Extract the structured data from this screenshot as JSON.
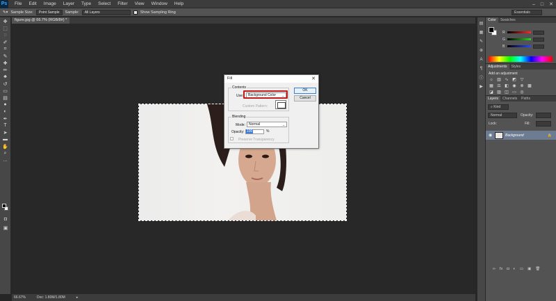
{
  "app": {
    "logo": "Ps"
  },
  "menu": [
    "File",
    "Edit",
    "Image",
    "Layer",
    "Type",
    "Select",
    "Filter",
    "View",
    "Window",
    "Help"
  ],
  "options": {
    "sample_size_label": "Sample Size:",
    "sample_size_value": "Point Sample",
    "sample_label": "Sample:",
    "sample_value": "All Layers",
    "show_ring_label": "Show Sampling Ring",
    "workspace": "Essentials"
  },
  "document": {
    "tab_title": "figure.jpg @ 66.7% (RGB/8#) *",
    "zoom": "66.67%",
    "doc_size": "Doc: 1.80M/1.80M"
  },
  "color_panel": {
    "tabs": [
      "Color",
      "Swatches"
    ],
    "channels": [
      {
        "name": "R",
        "color": "#ff3b3b"
      },
      {
        "name": "G",
        "color": "#3bd43b"
      },
      {
        "name": "B",
        "color": "#3b5bff"
      }
    ]
  },
  "adjustments_panel": {
    "tabs": [
      "Adjustments",
      "Styles"
    ],
    "title": "Add an adjustment"
  },
  "layers_panel": {
    "tabs": [
      "Layers",
      "Channels",
      "Paths"
    ],
    "kind_filter": "Kind",
    "blend_mode": "Normal",
    "opacity_label": "Opacity:",
    "lock_label": "Lock:",
    "fill_label": "Fill:",
    "layer_name": "Background"
  },
  "dialog": {
    "title": "Fill",
    "contents_label": "Contents",
    "use_label": "Use:",
    "use_value": "Background Color",
    "custom_pattern_label": "Custom Pattern:",
    "blending_label": "Blending",
    "mode_label": "Mode:",
    "mode_value": "Normal",
    "opacity_label": "Opacity:",
    "opacity_value": "100",
    "percent": "%",
    "preserve_label": "Preserve Transparency",
    "ok_label": "OK",
    "cancel_label": "Cancel"
  }
}
